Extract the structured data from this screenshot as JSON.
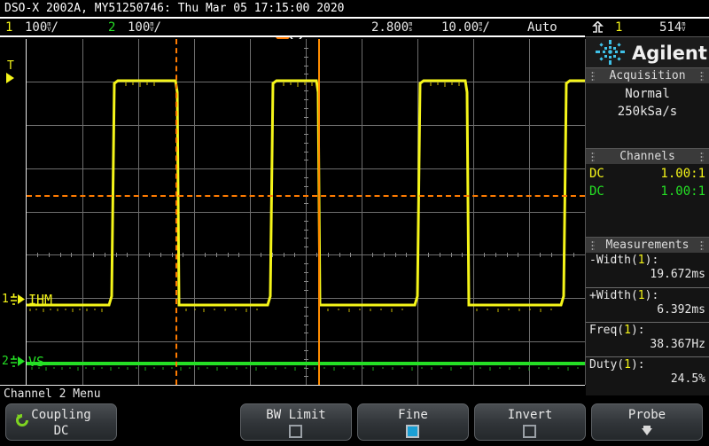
{
  "titlebar": {
    "text": "DSO-X 2002A, MY51250746: Thu Mar 05 17:15:00 2020"
  },
  "statusbar": {
    "ch1_num": "1",
    "ch1_scale": "100",
    "ch1_unit_top": "m",
    "ch1_unit_bot": "V",
    "ch1_per_div": "/",
    "ch2_num": "2",
    "ch2_scale": "100",
    "ch2_unit_top": "m",
    "ch2_unit_bot": "V",
    "ch2_per_div": "/",
    "delay": "2.800",
    "delay_unit_top": "m",
    "delay_unit_bot": "s",
    "timebase": "10.00",
    "timebase_unit_top": "m",
    "timebase_unit_bot": "s",
    "timebase_per_div": "/",
    "trig_mode": "Auto",
    "trig_icon": "rising-edge-icon",
    "trig_source": "1",
    "trig_level": "514",
    "trig_level_unit_top": "m",
    "trig_level_unit_bot": "V"
  },
  "plot": {
    "trigger_marker": "T",
    "ch1_marker": "1",
    "ch1_label": "IHM",
    "ch2_marker": "2",
    "ch2_label": "VS",
    "ch1_color": "#f5f519",
    "ch2_color": "#25e025",
    "cursor_color": "#ff7b00",
    "grid_color": "#6e6e6e"
  },
  "sidebar": {
    "brand": "Agilent",
    "brand_mark": "agilent-star-icon",
    "acquisition": {
      "title": "Acquisition",
      "mode": "Normal",
      "rate": "250kSa/s"
    },
    "channels": {
      "title": "Channels",
      "rows": [
        {
          "coupling": "DC",
          "probe": "1.00:1",
          "color": "#f5f519"
        },
        {
          "coupling": "DC",
          "probe": "1.00:1",
          "color": "#25e025"
        }
      ]
    },
    "measurements": {
      "title": "Measurements",
      "items": [
        {
          "name": "-Width(",
          "src": "1",
          "name_end": "):",
          "value": "19.672ms"
        },
        {
          "name": "+Width(",
          "src": "1",
          "name_end": "):",
          "value": "6.392ms"
        },
        {
          "name": "Freq(",
          "src": "1",
          "name_end": "):",
          "value": "38.367Hz"
        },
        {
          "name": "Duty(",
          "src": "1",
          "name_end": "):",
          "value": "24.5%"
        }
      ]
    }
  },
  "bottom": {
    "menu_title": "Channel 2 Menu",
    "keys": [
      {
        "label": "Coupling",
        "sub": "DC",
        "type": "cycle",
        "icon": "cycle-icon"
      },
      {
        "label": "BW Limit",
        "sub": "",
        "type": "checkbox",
        "checked": false
      },
      {
        "label": "Fine",
        "sub": "",
        "type": "checkbox",
        "checked": true
      },
      {
        "label": "Invert",
        "sub": "",
        "type": "checkbox",
        "checked": false
      },
      {
        "label": "Probe",
        "sub": "",
        "type": "submenu",
        "icon": "arrow-down-icon"
      }
    ]
  }
}
